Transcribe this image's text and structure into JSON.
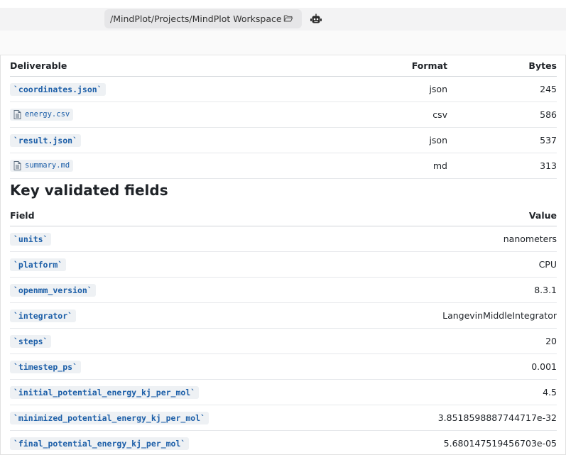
{
  "path_bar": {
    "path": "/MindPlot/Projects/MindPlot Workspace"
  },
  "deliverables": {
    "headers": {
      "name": "Deliverable",
      "format": "Format",
      "bytes": "Bytes"
    },
    "rows": [
      {
        "name": "`coordinates.json`",
        "kind": "code",
        "format": "json",
        "bytes": "245"
      },
      {
        "name": "energy.csv",
        "kind": "file",
        "format": "csv",
        "bytes": "586"
      },
      {
        "name": "`result.json`",
        "kind": "code",
        "format": "json",
        "bytes": "537"
      },
      {
        "name": "summary.md",
        "kind": "file",
        "format": "md",
        "bytes": "313"
      }
    ]
  },
  "validated": {
    "title": "Key validated fields",
    "headers": {
      "field": "Field",
      "value": "Value"
    },
    "rows": [
      {
        "field": "`units`",
        "value": "nanometers"
      },
      {
        "field": "`platform`",
        "value": "CPU"
      },
      {
        "field": "`openmm_version`",
        "value": "8.3.1"
      },
      {
        "field": "`integrator`",
        "value": "LangevinMiddleIntegrator"
      },
      {
        "field": "`steps`",
        "value": "20"
      },
      {
        "field": "`timestep_ps`",
        "value": "0.001"
      },
      {
        "field": "`initial_potential_energy_kj_per_mol`",
        "value": "4.5"
      },
      {
        "field": "`minimized_potential_energy_kj_per_mol`",
        "value": "3.8518598887744717e-32"
      },
      {
        "field": "`final_potential_energy_kj_per_mol`",
        "value": "5.680147519456703e-05"
      }
    ]
  }
}
